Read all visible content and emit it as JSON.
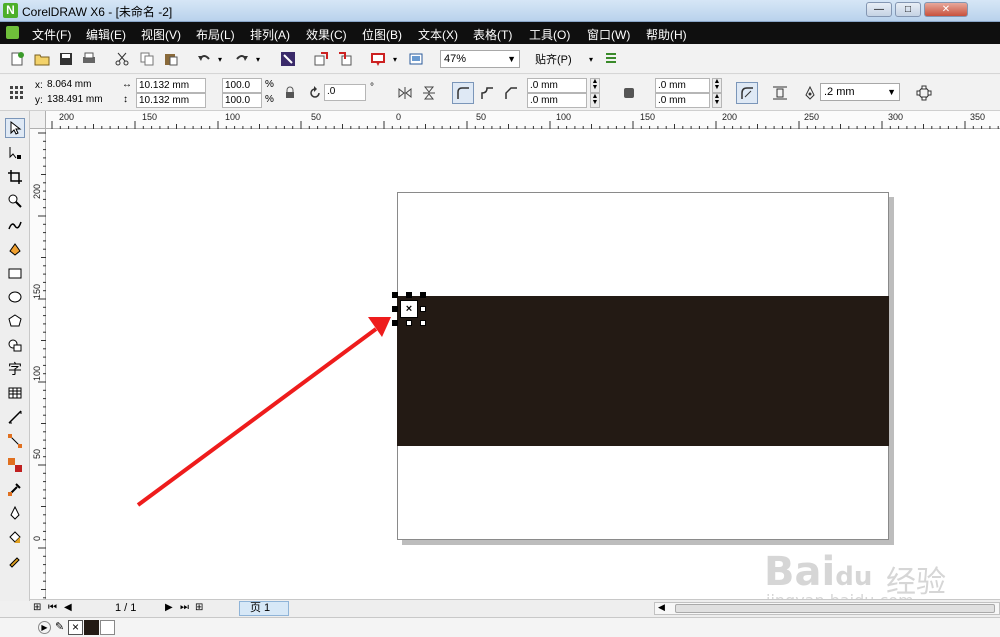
{
  "window": {
    "title": "CorelDRAW X6 - [未命名 -2]"
  },
  "menubar": {
    "items": [
      "文件(F)",
      "编辑(E)",
      "视图(V)",
      "布局(L)",
      "排列(A)",
      "效果(C)",
      "位图(B)",
      "文本(X)",
      "表格(T)",
      "工具(O)",
      "窗口(W)",
      "帮助(H)"
    ]
  },
  "toolbar": {
    "zoom_value": "47%",
    "snap_label": "贴齐(P)"
  },
  "property_bar": {
    "x_label": "x:",
    "x_value": "8.064 mm",
    "y_label": "y:",
    "y_value": "138.491 mm",
    "width_value": "10.132 mm",
    "height_value": "10.132 mm",
    "scale_x": "100.0",
    "scale_y": "100.0",
    "percent": "%",
    "rotation": ".0",
    "degree": "°",
    "corner1": ".0 mm",
    "corner2": ".0 mm",
    "corner3": ".0 mm",
    "corner4": ".0 mm",
    "outline_width": ".2 mm"
  },
  "ruler_h": {
    "labels": [
      "200",
      "150",
      "100",
      "50",
      "0",
      "50",
      "100",
      "150",
      "200",
      "250",
      "300",
      "350"
    ]
  },
  "ruler_v": {
    "labels": [
      "200",
      "150",
      "100",
      "50",
      "0"
    ]
  },
  "statusbar": {
    "page_count": "1 / 1",
    "page_tab": "页 1"
  },
  "colors": {
    "rectangle_fill": "#231a14",
    "arrow": "#ee1c1c",
    "menubar_bg": "#0f0f0f"
  },
  "watermark": {
    "brand": "Bai",
    "brand2": "du",
    "jingyan": "经验",
    "url": "jingyan.baidu.com"
  }
}
